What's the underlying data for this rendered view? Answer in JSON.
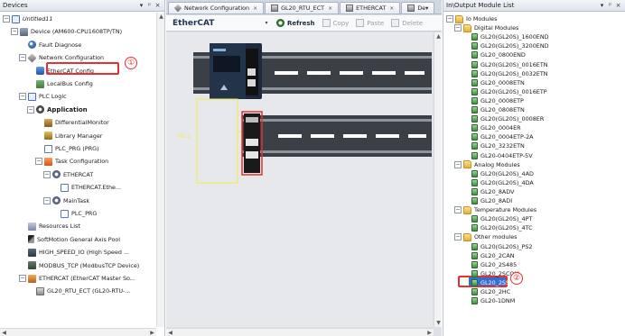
{
  "devices_pane": {
    "title": "Devices",
    "controls": [
      "▾",
      "ᵖ",
      "×"
    ],
    "items": [
      {
        "label": "Untitled11",
        "indent": 0,
        "exp": "⊟",
        "icon": "ic-plc",
        "italic": true
      },
      {
        "label": "Device (AM600-CPU1608TP/TN)",
        "indent": 1,
        "exp": "⊟",
        "icon": "ic-device"
      },
      {
        "label": "Fault Diagnose",
        "indent": 2,
        "exp": "",
        "icon": "ic-fault"
      },
      {
        "label": "Network Configuration",
        "indent": 2,
        "exp": "⊟",
        "icon": "ic-net"
      },
      {
        "label": "EtherCAT Config",
        "indent": 3,
        "exp": "",
        "icon": "ic-ecat"
      },
      {
        "label": "LocalBus Config",
        "indent": 3,
        "exp": "",
        "icon": "ic-local"
      },
      {
        "label": "PLC Logic",
        "indent": 2,
        "exp": "⊟",
        "icon": "ic-plc"
      },
      {
        "label": "Application",
        "indent": 3,
        "exp": "⊟",
        "icon": "ic-app",
        "bold": true
      },
      {
        "label": "DifferentialMonitor",
        "indent": 4,
        "exp": "",
        "icon": "ic-mon"
      },
      {
        "label": "Library Manager",
        "indent": 4,
        "exp": "",
        "icon": "ic-lib"
      },
      {
        "label": "PLC_PRG (PRG)",
        "indent": 4,
        "exp": "",
        "icon": "ic-prg"
      },
      {
        "label": "Task Configuration",
        "indent": 4,
        "exp": "⊟",
        "icon": "ic-task"
      },
      {
        "label": "ETHERCAT",
        "indent": 5,
        "exp": "⊟",
        "icon": "ic-gear"
      },
      {
        "label": "ETHERCAT.Ethe...",
        "indent": 6,
        "exp": "",
        "icon": "ic-prg"
      },
      {
        "label": "MainTask",
        "indent": 5,
        "exp": "⊟",
        "icon": "ic-gear"
      },
      {
        "label": "PLC_PRG",
        "indent": 6,
        "exp": "",
        "icon": "ic-prg"
      },
      {
        "label": "Resources List",
        "indent": 2,
        "exp": "",
        "icon": "ic-res"
      },
      {
        "label": "SoftMotion General Axis Pool",
        "indent": 2,
        "exp": "",
        "icon": "ic-axis"
      },
      {
        "label": "HIGH_SPEED_IO (High Speed ...",
        "indent": 2,
        "exp": "",
        "icon": "ic-hs"
      },
      {
        "label": "MODBUS_TCP (ModbusTCP Device)",
        "indent": 2,
        "exp": "",
        "icon": "ic-mod"
      },
      {
        "label": "ETHERCAT (EtherCAT Master So...",
        "indent": 2,
        "exp": "⊟",
        "icon": "ic-ecm"
      },
      {
        "label": "GL20_RTU_ECT (GL20-RTU-...",
        "indent": 3,
        "exp": "",
        "icon": "ic-rtu"
      }
    ],
    "callout": "①"
  },
  "editor": {
    "tabs": [
      {
        "label": "Network Configuration",
        "close": "×"
      },
      {
        "label": "GL20_RTU_ECT",
        "close": "×"
      },
      {
        "label": "ETHERCAT",
        "close": "×"
      },
      {
        "label": "De▾",
        "close": ""
      }
    ],
    "toolbar_title": "EtherCAT",
    "dropdown": "▾",
    "buttons": {
      "refresh": "Refresh",
      "copy": "Copy",
      "paste": "Paste",
      "delete": "Delete"
    },
    "slot_label": "No.1"
  },
  "modules_pane": {
    "title": "In\\Output Module List",
    "controls": [
      "▾",
      "ᵖ",
      "×"
    ],
    "items": [
      {
        "label": "Io Modules",
        "indent": 0,
        "exp": "⊟",
        "icon": "ic-folder"
      },
      {
        "label": "Digital Modules",
        "indent": 1,
        "exp": "⊟",
        "icon": "ic-folder"
      },
      {
        "label": "GL20(GL20S)_1600END",
        "indent": 2,
        "icon": "ic-module"
      },
      {
        "label": "GL20(GL20S)_3200END",
        "indent": 2,
        "icon": "ic-module"
      },
      {
        "label": "GL20_0800END",
        "indent": 2,
        "icon": "ic-module"
      },
      {
        "label": "GL20(GL20S)_0016ETN",
        "indent": 2,
        "icon": "ic-module"
      },
      {
        "label": "GL20(GL20S)_0032ETN",
        "indent": 2,
        "icon": "ic-module"
      },
      {
        "label": "GL20_0008ETN",
        "indent": 2,
        "icon": "ic-module"
      },
      {
        "label": "GL20(GL20S)_0016ETP",
        "indent": 2,
        "icon": "ic-module"
      },
      {
        "label": "GL20_0008ETP",
        "indent": 2,
        "icon": "ic-module"
      },
      {
        "label": "GL20_0808ETN",
        "indent": 2,
        "icon": "ic-module"
      },
      {
        "label": "GL20(GL20S)_0008ER",
        "indent": 2,
        "icon": "ic-module"
      },
      {
        "label": "GL20_0004ER",
        "indent": 2,
        "icon": "ic-module"
      },
      {
        "label": "GL20_0004ETP-2A",
        "indent": 2,
        "icon": "ic-module"
      },
      {
        "label": "GL20_3232ETN",
        "indent": 2,
        "icon": "ic-module"
      },
      {
        "label": "GL20-0404ETP-5V",
        "indent": 2,
        "icon": "ic-module"
      },
      {
        "label": "Analog Modules",
        "indent": 1,
        "exp": "⊟",
        "icon": "ic-folder"
      },
      {
        "label": "GL20(GL20S)_4AD",
        "indent": 2,
        "icon": "ic-module"
      },
      {
        "label": "GL20(GL20S)_4DA",
        "indent": 2,
        "icon": "ic-module"
      },
      {
        "label": "GL20_8ADV",
        "indent": 2,
        "icon": "ic-module"
      },
      {
        "label": "GL20_8ADI",
        "indent": 2,
        "icon": "ic-module"
      },
      {
        "label": "Temperature Modules",
        "indent": 1,
        "exp": "⊟",
        "icon": "ic-folder"
      },
      {
        "label": "GL20(GL20S)_4PT",
        "indent": 2,
        "icon": "ic-module"
      },
      {
        "label": "GL20(GL20S)_4TC",
        "indent": 2,
        "icon": "ic-module"
      },
      {
        "label": "Other modules",
        "indent": 1,
        "exp": "⊟",
        "icon": "ic-folder"
      },
      {
        "label": "GL20(GL20S)_PS2",
        "indent": 2,
        "icon": "ic-module"
      },
      {
        "label": "GL20_2CAN",
        "indent": 2,
        "icon": "ic-module"
      },
      {
        "label": "GL20_2S485",
        "indent": 2,
        "icon": "ic-module"
      },
      {
        "label": "GL20_2SCOM",
        "indent": 2,
        "icon": "ic-module"
      },
      {
        "label": "GL20_2SSI",
        "indent": 2,
        "icon": "ic-module"
      },
      {
        "label": "GL20_2HC",
        "indent": 2,
        "icon": "ic-module"
      },
      {
        "label": "GL20-1DNM",
        "indent": 2,
        "icon": "ic-module"
      }
    ],
    "callout": "②"
  },
  "colors": {
    "accent": "#e5312f",
    "selection": "#2f6fd6",
    "rail": "#3b3f46",
    "slot": "#f2ee3c"
  }
}
